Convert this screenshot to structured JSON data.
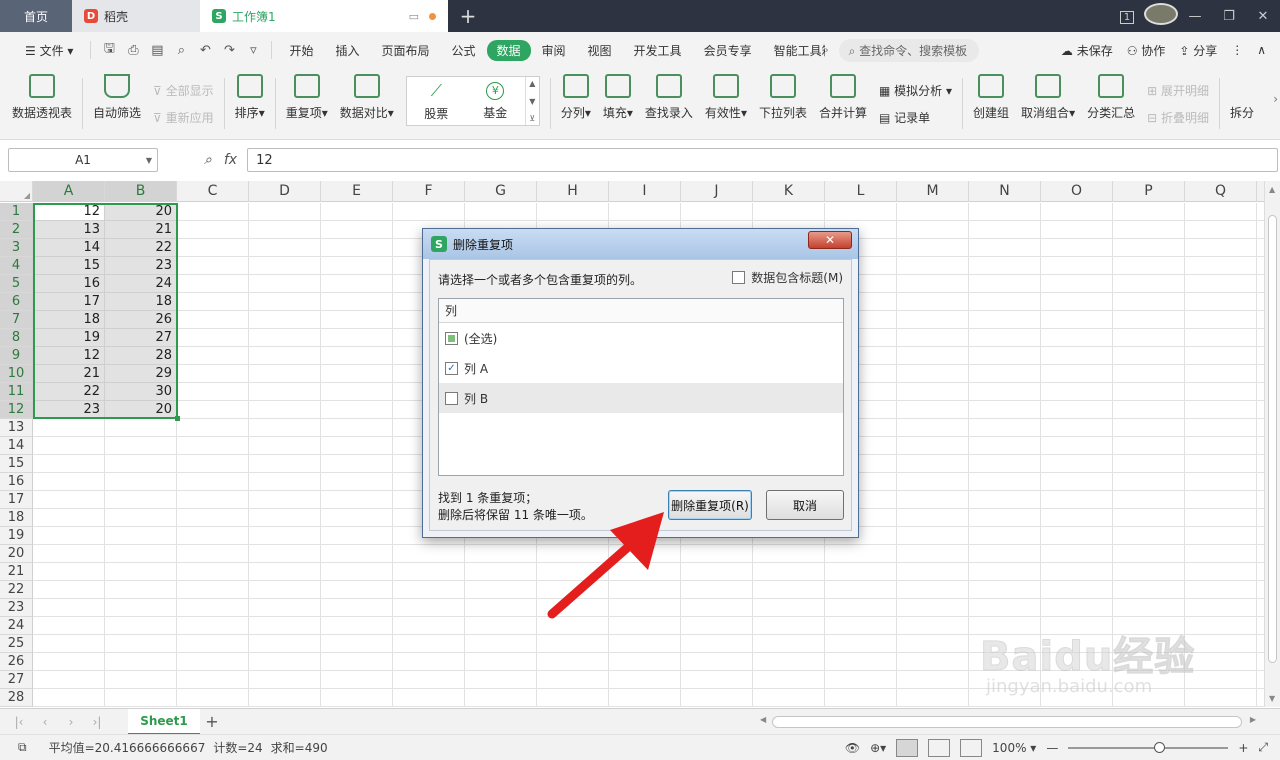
{
  "tabs": {
    "home": "首页",
    "daoke": "稻壳",
    "workbook": "工作簿1",
    "window_badge": "1"
  },
  "menu": {
    "file": "文件",
    "items": [
      "开始",
      "插入",
      "页面布局",
      "公式",
      "数据",
      "审阅",
      "视图",
      "开发工具",
      "会员专享",
      "智能工具箱"
    ],
    "active": "数据",
    "search_placeholder": "查找命令、搜索模板",
    "unsaved": "未保存",
    "collab": "协作",
    "share": "分享"
  },
  "ribbon": {
    "pivot": "数据透视表",
    "autofilter": "自动筛选",
    "show_all": "全部显示",
    "reapply": "重新应用",
    "sort": "排序",
    "duplicates": "重复项",
    "compare": "数据对比",
    "stock": "股票",
    "fund": "基金",
    "split": "分列",
    "fill": "填充",
    "lookup_entry": "查找录入",
    "validity": "有效性",
    "dropdown_list": "下拉列表",
    "consolidate": "合并计算",
    "what_if": "模拟分析",
    "record_form": "记录单",
    "create_group": "创建组",
    "ungroup": "取消组合",
    "subtotal": "分类汇总",
    "expand_detail": "展开明细",
    "collapse_detail": "折叠明细",
    "split_table": "拆分"
  },
  "formula_bar": {
    "cell_ref": "A1",
    "fx": "fx",
    "value": "12"
  },
  "columns": [
    "A",
    "B",
    "C",
    "D",
    "E",
    "F",
    "G",
    "H",
    "I",
    "J",
    "K",
    "L",
    "M",
    "N",
    "O",
    "P",
    "Q"
  ],
  "rows": [
    "1",
    "2",
    "3",
    "4",
    "5",
    "6",
    "7",
    "8",
    "9",
    "10",
    "11",
    "12",
    "13",
    "14",
    "15",
    "16",
    "17",
    "18",
    "19",
    "20",
    "21",
    "22",
    "23",
    "24",
    "25",
    "26",
    "27",
    "28"
  ],
  "cells": {
    "A": [
      "12",
      "13",
      "14",
      "15",
      "16",
      "17",
      "18",
      "19",
      "12",
      "21",
      "22",
      "23"
    ],
    "B": [
      "20",
      "21",
      "22",
      "23",
      "24",
      "18",
      "26",
      "27",
      "28",
      "29",
      "30",
      "20"
    ]
  },
  "sheet": {
    "name": "Sheet1"
  },
  "status": {
    "average": "平均值=20.416666666667",
    "count": "计数=24",
    "sum": "求和=490",
    "zoom": "100%"
  },
  "dialog": {
    "title": "删除重复项",
    "close": "✕",
    "prompt": "请选择一个或者多个包含重复项的列。",
    "header_checkbox": "数据包含标题(M)",
    "list_header": "列",
    "items": [
      {
        "label": "(全选)",
        "state": "partial"
      },
      {
        "label": "列 A",
        "state": "checked"
      },
      {
        "label": "列 B",
        "state": "unchecked"
      }
    ],
    "info_line1": "找到 1 条重复项；",
    "info_line2": "删除后将保留 11 条唯一项。",
    "remove_button": "删除重复项(R)",
    "cancel_button": "取消"
  },
  "watermark": {
    "brand": "Baidu经验",
    "url": "jingyan.baidu.com"
  },
  "colors": {
    "accent": "#2ea561",
    "selection": "#2e9a4d",
    "arrow": "#e41d1d"
  }
}
